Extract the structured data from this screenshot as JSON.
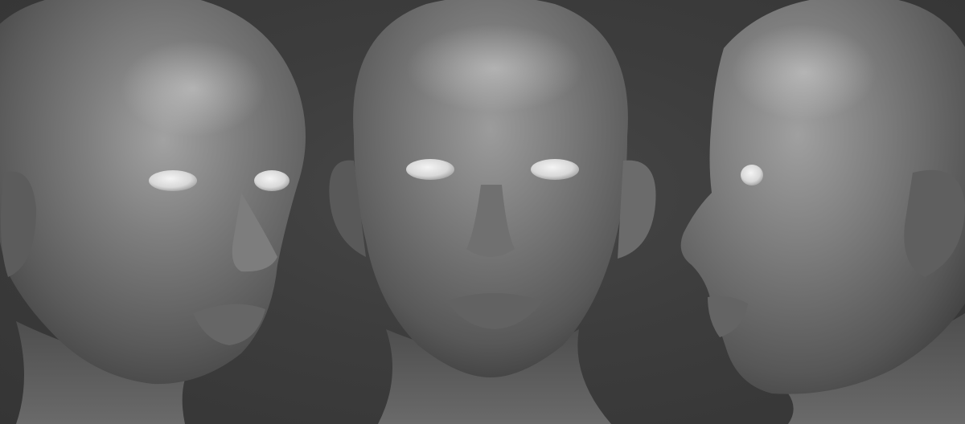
{
  "scene": {
    "subject": "sculpted-head-turnaround",
    "views": [
      {
        "id": "three-quarter-left",
        "icon": "head-three-quarter-icon"
      },
      {
        "id": "front",
        "icon": "head-front-icon"
      },
      {
        "id": "profile-right",
        "icon": "head-profile-icon"
      }
    ],
    "colors": {
      "background": "#3a3a3a",
      "clay_light": "#9a9a9a",
      "clay_mid": "#6e6e6e",
      "clay_dark": "#3e3e3e",
      "eye": "#e6e6e6"
    }
  }
}
